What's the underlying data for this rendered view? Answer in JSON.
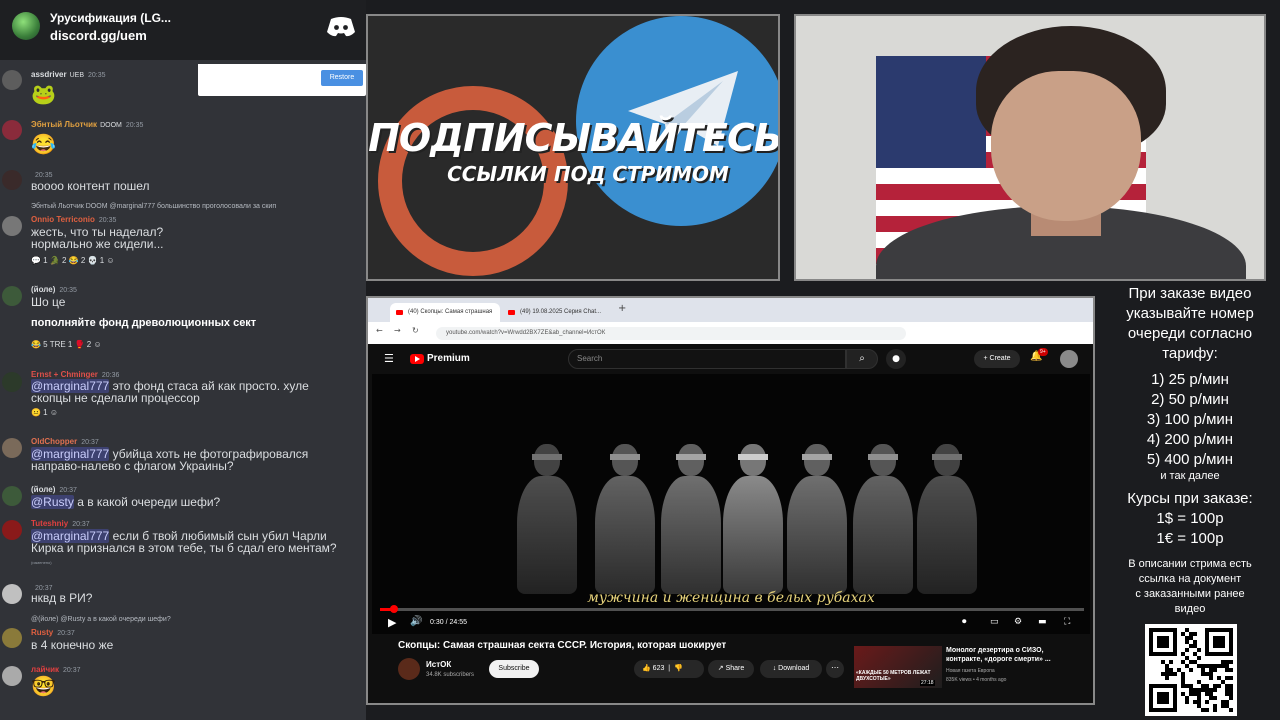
{
  "chat": {
    "server_name": "Урусификация (LG...",
    "server_link": "discord.gg/uem",
    "restore_label": "Restore",
    "messages": [
      {
        "user": "assdriver",
        "badge": "UEB",
        "time": "20:35",
        "emoji": "🐸"
      },
      {
        "user": "Эбнтый Льотчик",
        "badge": "DOOM",
        "time": "20:35",
        "emoji": "😂"
      },
      {
        "user": "",
        "time": "20:35",
        "text": "воооо контент пошел"
      },
      {
        "reply": "Эбнтый Льотчик DOOM @marginal777 большинство проголосовали за скип",
        "user": "Onnio Terriconio",
        "time": "20:35",
        "lines": [
          "жесть, что ты наделал?",
          "нормально же сидели..."
        ],
        "reactions": "💬 1   🐊 2   😂 2   💀 1   ☺"
      },
      {
        "user": "(йоле)",
        "time": "20:35",
        "text": "Шо це",
        "bold": "пополняйте фонд древолюционных сект",
        "reactions": "😂 5   TRE 1   🥊 2   ☺"
      },
      {
        "user": "Ernst + Chminger",
        "time": "20:36",
        "mention": "@marginal777",
        "lines": [
          " это фонд стаса ай как просто. хуле",
          "скопцы не сделали процессор"
        ],
        "reactions": "😐 1   ☺"
      },
      {
        "user": "OldChopper",
        "time": "20:37",
        "mention": "@marginal777",
        "lines": [
          " убийца хоть не фотографировался",
          "направо-налево с флагом Украины?"
        ]
      },
      {
        "user": "(йоле)",
        "time": "20:37",
        "mention": "@Rusty",
        "lines": [
          " а в какой очереди шефи?"
        ]
      },
      {
        "user": "Tuteshniy",
        "time": "20:37",
        "mention": "@marginal777",
        "lines": [
          " если б твой любимый сын убил Чарли",
          "Кирка и признался в этом тебе, ты б сдал его ментам?"
        ],
        "sub": "(изменено)"
      },
      {
        "user": "",
        "time": "20:37",
        "text": "нквд в РИ?"
      },
      {
        "reply": "@(йоле) @Rusty а в какой очереди шефи?",
        "user": "Rusty",
        "time": "20:37",
        "text": "в 4 конечно же"
      },
      {
        "user": "лайчик",
        "time": "20:37",
        "emoji": "🤓"
      }
    ]
  },
  "promo": {
    "title": "ПОДПИСЫВАЙТЕСЬ",
    "subtitle": "ССЫЛКИ ПОД СТРИМОМ"
  },
  "browser": {
    "tab1": "(40) Скопцы: Самая страшная",
    "tab2": "(49) 19.08.2025 Серия Chat...",
    "url": "youtube.com/watch?v=Wrwdd2BX7ZE&ab_channel=ИстОК",
    "yt": {
      "brand": "Premium",
      "search_placeholder": "Search",
      "create_label": "Create",
      "bell_count": "9+",
      "subtitle_text": "мужчина и женщина в белых рубахах",
      "time_display": "0:30 / 24:55",
      "progress_fraction": 0.02,
      "video_title": "Скопцы: Самая страшная секта СССР. История, которая шокирует",
      "channel_name": "ИстОК",
      "channel_subs": "34.8K subscribers",
      "subscribe_label": "Subscribe",
      "likes": "623",
      "share_label": "Share",
      "download_label": "Download",
      "rec_thumb_text": "«КАЖДЫЕ 50 МЕТРОВ ЛЕЖАТ ДВУХСОТЫЕ»",
      "rec_duration": "27:18",
      "rec_title": "Монолог дезертира о СИЗО, контракте, «дороге смерти» ...",
      "rec_channel": "Новая газета Европа",
      "rec_meta": "835K views • 4 months ago"
    }
  },
  "info": {
    "intro": [
      "При заказе видео",
      "указывайте номер",
      "очереди согласно",
      "тарифу:"
    ],
    "tariffs": [
      "1) 25 р/мин",
      "2) 50 р/мин",
      "3) 100 р/мин",
      "4) 200 р/мин",
      "5) 400 р/мин"
    ],
    "etc": "и так далее",
    "rates_title": "Курсы при заказе:",
    "rates": [
      "1$ = 100р",
      "1€ = 100р"
    ],
    "note": [
      "В описании стрима есть",
      "ссылка на документ",
      "с заказанными ранее",
      "видео"
    ]
  }
}
